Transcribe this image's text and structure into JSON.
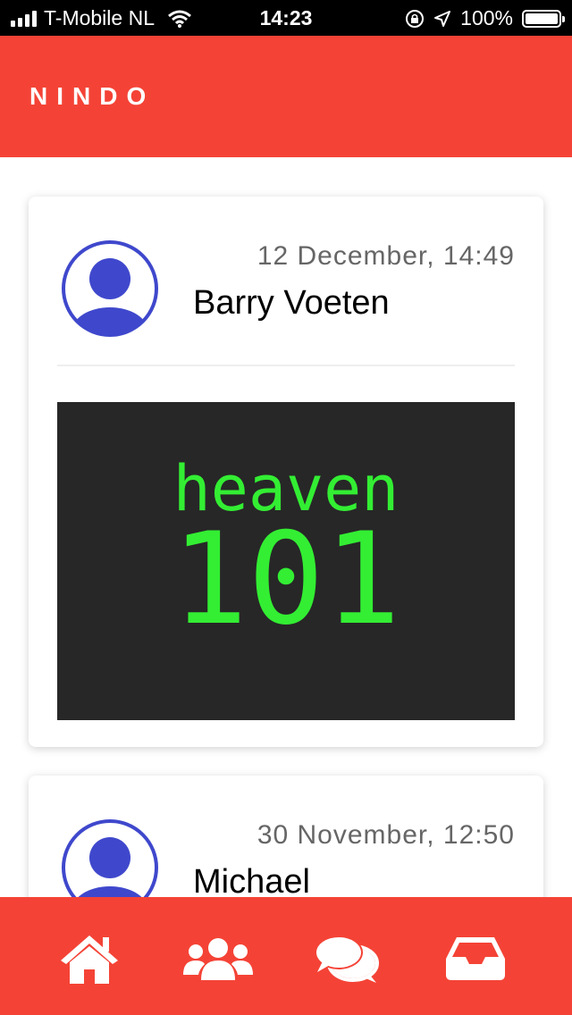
{
  "status_bar": {
    "carrier": "T-Mobile NL",
    "time": "14:23",
    "battery": "100%"
  },
  "header": {
    "brand": "NINDO"
  },
  "feed": {
    "posts": [
      {
        "date": "12 December, 14:49",
        "author": "Barry Voeten",
        "image_text": [
          "heaven",
          "101"
        ]
      },
      {
        "date": "30 November, 12:50",
        "author": "Michael"
      }
    ]
  },
  "bottom_nav": {
    "items": [
      {
        "icon": "home-icon"
      },
      {
        "icon": "users-icon"
      },
      {
        "icon": "chat-icon"
      },
      {
        "icon": "inbox-icon"
      }
    ]
  },
  "colors": {
    "primary": "#f44336",
    "avatar": "#3f48cc",
    "image_bg": "#272727",
    "image_text": "#33ee33"
  }
}
